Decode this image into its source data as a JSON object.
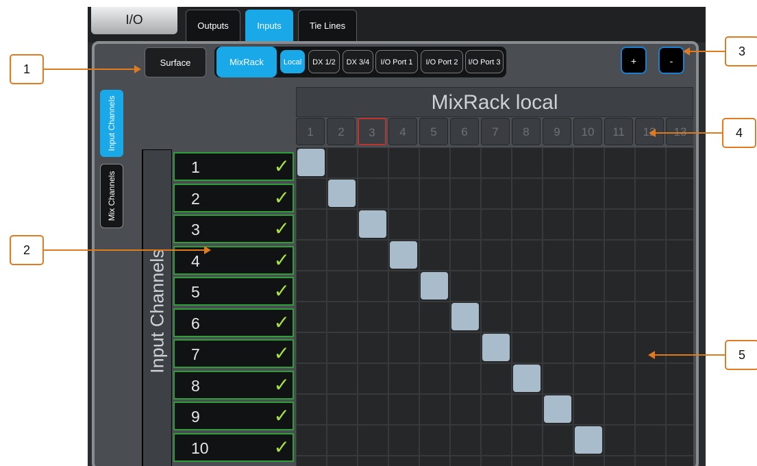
{
  "header": {
    "title": "I/O"
  },
  "tabs": [
    {
      "label": "Outputs",
      "active": false
    },
    {
      "label": "Inputs",
      "active": true
    },
    {
      "label": "Tie Lines",
      "active": false
    }
  ],
  "source": {
    "surface_label": "Surface",
    "mixrack_label": "MixRack",
    "subs": [
      {
        "label": "Local",
        "active": true
      },
      {
        "label": "DX 1/2",
        "active": false
      },
      {
        "label": "DX 3/4",
        "active": false
      },
      {
        "label": "I/O Port 1",
        "active": false
      },
      {
        "label": "I/O Port 2",
        "active": false
      },
      {
        "label": "I/O Port 3",
        "active": false
      }
    ]
  },
  "zoom": {
    "plus_label": "+",
    "minus_label": "-"
  },
  "side_tabs": [
    {
      "label": "Input Channels",
      "active": true
    },
    {
      "label": "Mix Channels",
      "active": false
    }
  ],
  "grid": {
    "title": "MixRack local",
    "row_axis_label": "Input Channels",
    "columns": [
      "1",
      "2",
      "3",
      "4",
      "5",
      "6",
      "7",
      "8",
      "9",
      "10",
      "11",
      "12",
      "13"
    ],
    "selected_column": "3",
    "rows": [
      "1",
      "2",
      "3",
      "4",
      "5",
      "6",
      "7",
      "8",
      "9",
      "10"
    ],
    "check_symbol": "✓",
    "patches": [
      [
        1,
        1
      ],
      [
        2,
        2
      ],
      [
        3,
        3
      ],
      [
        4,
        4
      ],
      [
        5,
        5
      ],
      [
        6,
        6
      ],
      [
        7,
        7
      ],
      [
        8,
        8
      ],
      [
        9,
        9
      ],
      [
        10,
        10
      ]
    ]
  },
  "callouts": [
    "1",
    "2",
    "3",
    "4",
    "5"
  ],
  "colors": {
    "accent": "#19a8e8",
    "patch": "#a9bccb",
    "callout": "#e07a1f",
    "row_border": "#2f9e3a",
    "check": "#a9e33f"
  }
}
